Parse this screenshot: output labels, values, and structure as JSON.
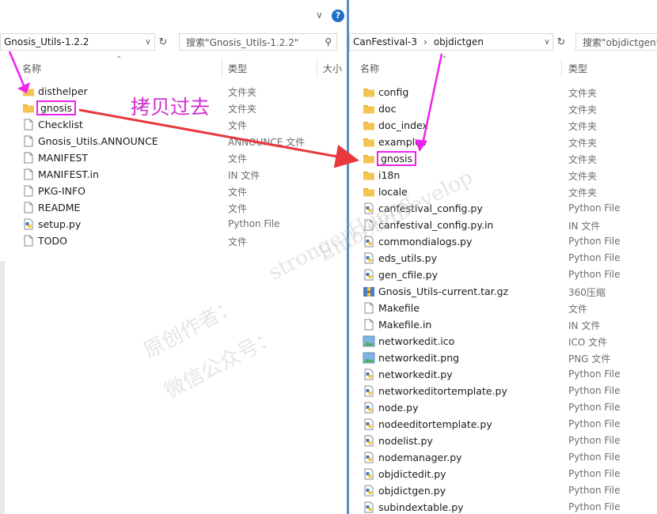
{
  "left": {
    "address": "Gnosis_Utils-1.2.2",
    "search_placeholder": "搜索\"Gnosis_Utils-1.2.2\"",
    "columns": {
      "name": "名称",
      "type": "类型",
      "size": "大小"
    },
    "help_label": "?",
    "files": [
      {
        "name": "disthelper",
        "type": "文件夹",
        "icon": "folder-icon"
      },
      {
        "name": "gnosis",
        "type": "文件夹",
        "icon": "folder-icon"
      },
      {
        "name": "Checklist",
        "type": "文件",
        "icon": "file-icon"
      },
      {
        "name": "Gnosis_Utils.ANNOUNCE",
        "type": "ANNOUNCE 文件",
        "icon": "file-icon"
      },
      {
        "name": "MANIFEST",
        "type": "文件",
        "icon": "file-icon"
      },
      {
        "name": "MANIFEST.in",
        "type": "IN 文件",
        "icon": "file-icon"
      },
      {
        "name": "PKG-INFO",
        "type": "文件",
        "icon": "file-icon"
      },
      {
        "name": "README",
        "type": "文件",
        "icon": "file-icon"
      },
      {
        "name": "setup.py",
        "type": "Python File",
        "icon": "python-file-icon"
      },
      {
        "name": "TODO",
        "type": "文件",
        "icon": "file-icon"
      }
    ]
  },
  "right": {
    "breadcrumb": [
      "CanFestival-3",
      "objdictgen"
    ],
    "breadcrumb_sep": "›",
    "search_placeholder": "搜索\"objdictgen\"",
    "columns": {
      "name": "名称",
      "type": "类型"
    },
    "files": [
      {
        "name": "config",
        "type": "文件夹",
        "icon": "folder-icon"
      },
      {
        "name": "doc",
        "type": "文件夹",
        "icon": "folder-icon"
      },
      {
        "name": "doc_index",
        "type": "文件夹",
        "icon": "folder-icon"
      },
      {
        "name": "examples",
        "type": "文件夹",
        "icon": "folder-icon"
      },
      {
        "name": "gnosis",
        "type": "文件夹",
        "icon": "folder-icon"
      },
      {
        "name": "i18n",
        "type": "文件夹",
        "icon": "folder-icon"
      },
      {
        "name": "locale",
        "type": "文件夹",
        "icon": "folder-icon"
      },
      {
        "name": "canfestival_config.py",
        "type": "Python File",
        "icon": "python-file-icon"
      },
      {
        "name": "canfestival_config.py.in",
        "type": "IN 文件",
        "icon": "file-icon"
      },
      {
        "name": "commondialogs.py",
        "type": "Python File",
        "icon": "python-file-icon"
      },
      {
        "name": "eds_utils.py",
        "type": "Python File",
        "icon": "python-file-icon"
      },
      {
        "name": "gen_cfile.py",
        "type": "Python File",
        "icon": "python-file-icon"
      },
      {
        "name": "Gnosis_Utils-current.tar.gz",
        "type": "360压缩",
        "icon": "archive-icon"
      },
      {
        "name": "Makefile",
        "type": "文件",
        "icon": "file-icon"
      },
      {
        "name": "Makefile.in",
        "type": "IN 文件",
        "icon": "file-icon"
      },
      {
        "name": "networkedit.ico",
        "type": "ICO 文件",
        "icon": "image-icon"
      },
      {
        "name": "networkedit.png",
        "type": "PNG 文件",
        "icon": "image-icon"
      },
      {
        "name": "networkedit.py",
        "type": "Python File",
        "icon": "python-file-icon"
      },
      {
        "name": "networkeditortemplate.py",
        "type": "Python File",
        "icon": "python-file-icon"
      },
      {
        "name": "node.py",
        "type": "Python File",
        "icon": "python-file-icon"
      },
      {
        "name": "nodeeditortemplate.py",
        "type": "Python File",
        "icon": "python-file-icon"
      },
      {
        "name": "nodelist.py",
        "type": "Python File",
        "icon": "python-file-icon"
      },
      {
        "name": "nodemanager.py",
        "type": "Python File",
        "icon": "python-file-icon"
      },
      {
        "name": "objdictedit.py",
        "type": "Python File",
        "icon": "python-file-icon"
      },
      {
        "name": "objdictgen.py",
        "type": "Python File",
        "icon": "python-file-icon"
      },
      {
        "name": "subindextable.py",
        "type": "Python File",
        "icon": "python-file-icon"
      }
    ]
  },
  "annotation": {
    "text": "拷贝过去",
    "color": "#d030d0",
    "arrow_color": "#e8383d",
    "pointer_color": "#ee22ee"
  },
  "watermark": {
    "line1": "strongerHuang",
    "line2": "原创作者：",
    "line3": "EmbeddDevelop",
    "line4": "微信公众号："
  },
  "colors": {
    "divider": "#5b8ec9",
    "help": "#1e6fc8",
    "folder": "#f3c451"
  }
}
